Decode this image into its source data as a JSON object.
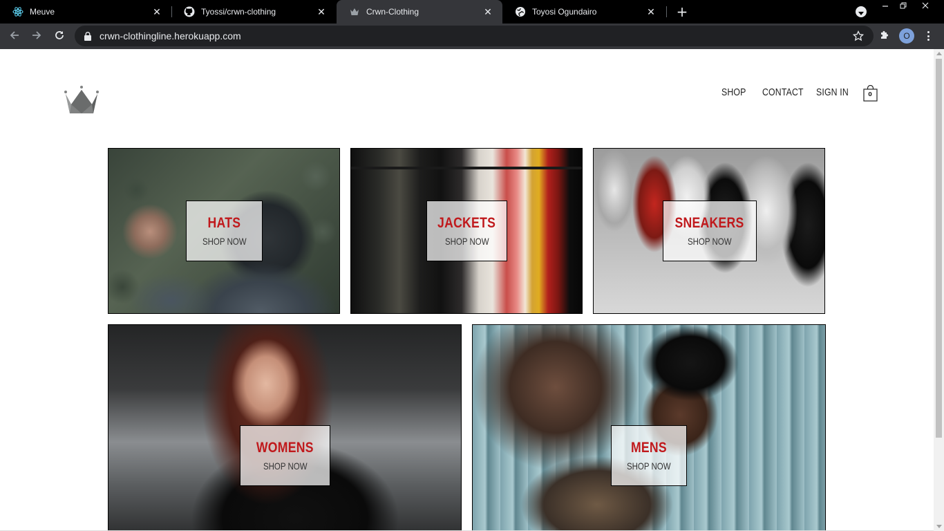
{
  "browser": {
    "tabs": [
      {
        "title": "Meuve",
        "icon": "react-icon",
        "active": false
      },
      {
        "title": "Tyossi/crwn-clothing",
        "icon": "github-icon",
        "active": false
      },
      {
        "title": "Crwn-Clothing",
        "icon": "crown-icon",
        "active": true
      },
      {
        "title": "Toyosi Ogundairo",
        "icon": "globe-icon",
        "active": false
      }
    ],
    "url": "crwn-clothingline.herokuapp.com",
    "profile_initial": "O",
    "close_glyph": "✕",
    "new_tab_glyph": "+"
  },
  "header": {
    "nav": {
      "shop": "SHOP",
      "contact": "CONTACT",
      "sign_in": "SIGN IN"
    },
    "cart_count": "0"
  },
  "directory": [
    {
      "title": "HATS",
      "subtitle": "SHOP NOW"
    },
    {
      "title": "JACKETS",
      "subtitle": "SHOP NOW"
    },
    {
      "title": "SNEAKERS",
      "subtitle": "SHOP NOW"
    },
    {
      "title": "WOMENS",
      "subtitle": "SHOP NOW"
    },
    {
      "title": "MENS",
      "subtitle": "SHOP NOW"
    }
  ],
  "colors": {
    "accent_red": "#c0191c",
    "chrome_dark": "#35363a"
  }
}
